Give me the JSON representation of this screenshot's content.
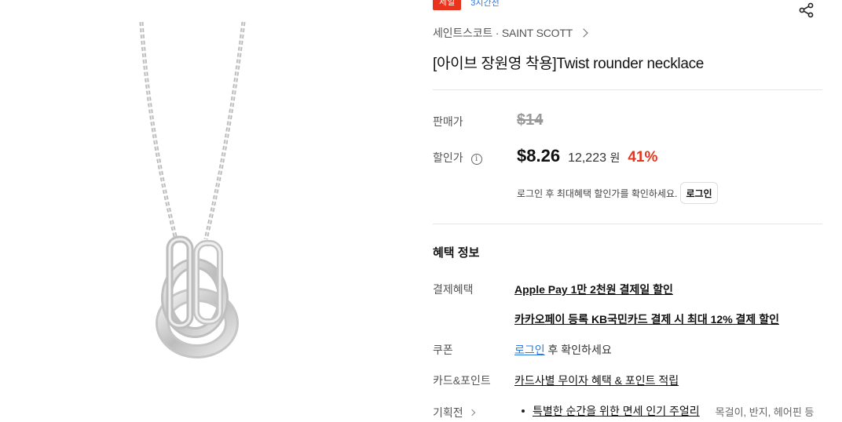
{
  "badge": {
    "sale": "세일",
    "time_left": "3시간전"
  },
  "brand": {
    "name": "세인트스코트 · SAINT SCOTT"
  },
  "product": {
    "title": "[아이브 장원영 착용]Twist rounder necklace"
  },
  "price": {
    "original_label": "판매가",
    "original": "$14",
    "sale_label": "할인가",
    "sale": "$8.26",
    "krw": "12,223",
    "krw_unit": "원",
    "discount": "41%",
    "login_note": "로그인 후 최대혜택 할인가를 확인하세요.",
    "login_button": "로그인"
  },
  "benefits": {
    "title": "혜택 정보",
    "payment_label": "결제혜택",
    "payment_1": "Apple Pay 1만 2천원 결제일 할인",
    "payment_2": "카카오페이 등록 KB국민카드 결제 시 최대 12% 결제 할인",
    "coupon_label": "쿠폰",
    "coupon_link": "로그인",
    "coupon_rest": " 후 확인하세요",
    "card_label": "카드&포인트",
    "card_value": "카드사별 무이자 혜택 & 포인트 적립",
    "plan_label": "기획전",
    "plan_item": "특별한 순간을 위한 면세 인기 주얼리",
    "plan_tags": "목걸이, 반지, 헤어핀 등"
  },
  "icons": {
    "share": "share-icon",
    "info": "info-icon",
    "chevron": "chevron-right-icon"
  },
  "colors": {
    "accent_red": "#e8341c",
    "link_blue": "#2b7be4"
  }
}
